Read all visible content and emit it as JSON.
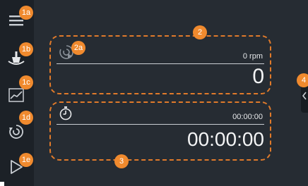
{
  "badges": {
    "b1a": "1a",
    "b1b": "1b",
    "b1c": "1c",
    "b1d": "1d",
    "b1e": "1e",
    "b2": "2",
    "b2a": "2a",
    "b3": "3",
    "b4": "4"
  },
  "sidebar": {
    "items": [
      {
        "icon": "menu-icon"
      },
      {
        "icon": "mixer-icon"
      },
      {
        "icon": "chart-icon"
      },
      {
        "icon": "rotation-icon"
      },
      {
        "icon": "play-icon"
      }
    ]
  },
  "speed_panel": {
    "unit_label": "0 rpm",
    "value": "0"
  },
  "timer_panel": {
    "small_time": "00:00:00",
    "big_time": "00:00:00"
  },
  "colors": {
    "background": "#262c33",
    "sidebar": "#1c2127",
    "accent_orange": "#f08a2e",
    "text": "#f3f4f5"
  }
}
